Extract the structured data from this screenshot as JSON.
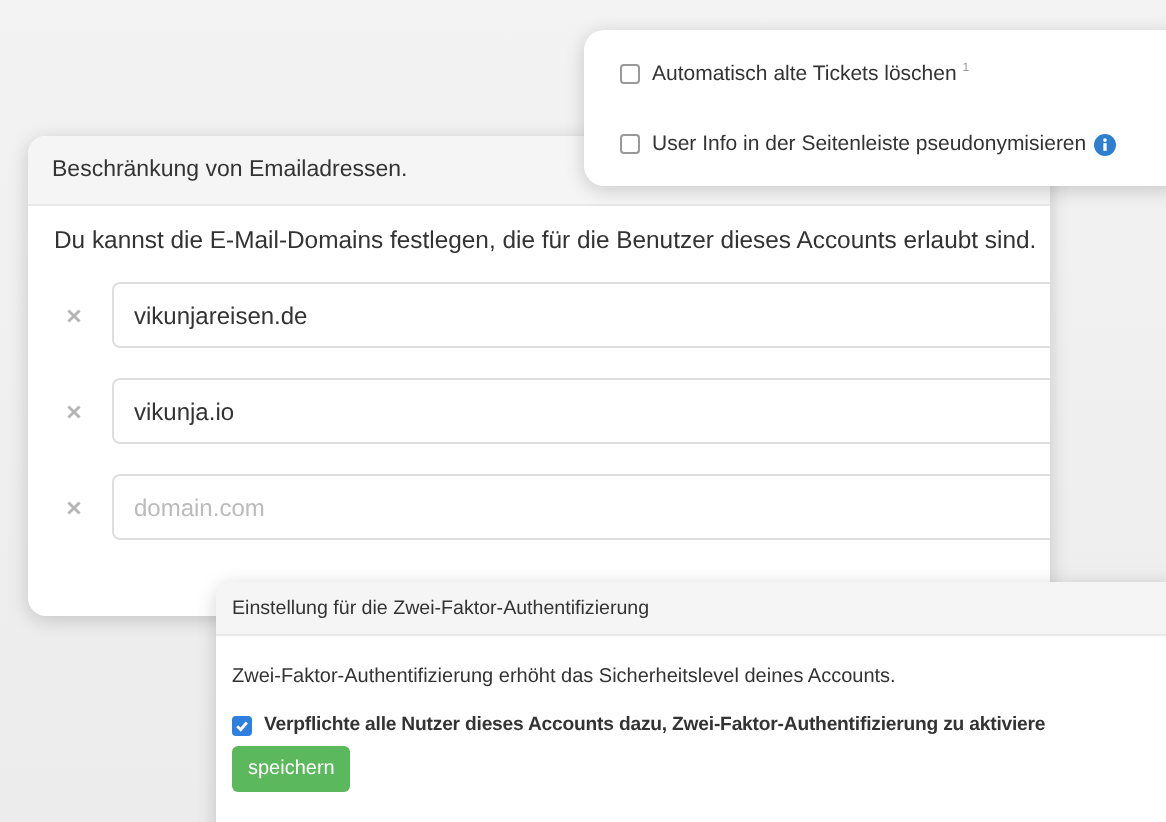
{
  "settings_popover": {
    "options": [
      {
        "label": "Automatisch alte Tickets löschen $^{1}$",
        "checked": false,
        "info": false
      },
      {
        "label": "User Info in der Seitenleiste pseudonymisieren",
        "checked": false,
        "info": true
      }
    ]
  },
  "email_panel": {
    "title": "Beschränkung von Emailadressen.",
    "description": "Du kannst die E-Mail-Domains festlegen, die für die Benutzer dieses Accounts erlaubt sind.",
    "domains": [
      {
        "value": "vikunjareisen.de"
      },
      {
        "value": "vikunja.io"
      },
      {
        "placeholder": "domain.com"
      }
    ]
  },
  "two_factor_panel": {
    "title": "Einstellung für die Zwei-Faktor-Authentifizierung",
    "description": "Zwei-Faktor-Authentifizierung erhöht das Sicherheitslevel deines Accounts.",
    "option": {
      "label": "Verpflichte alle Nutzer dieses Accounts dazu, Zwei-Faktor-Authentifizierung zu aktiviere",
      "checked": true
    },
    "button": "speichern"
  }
}
